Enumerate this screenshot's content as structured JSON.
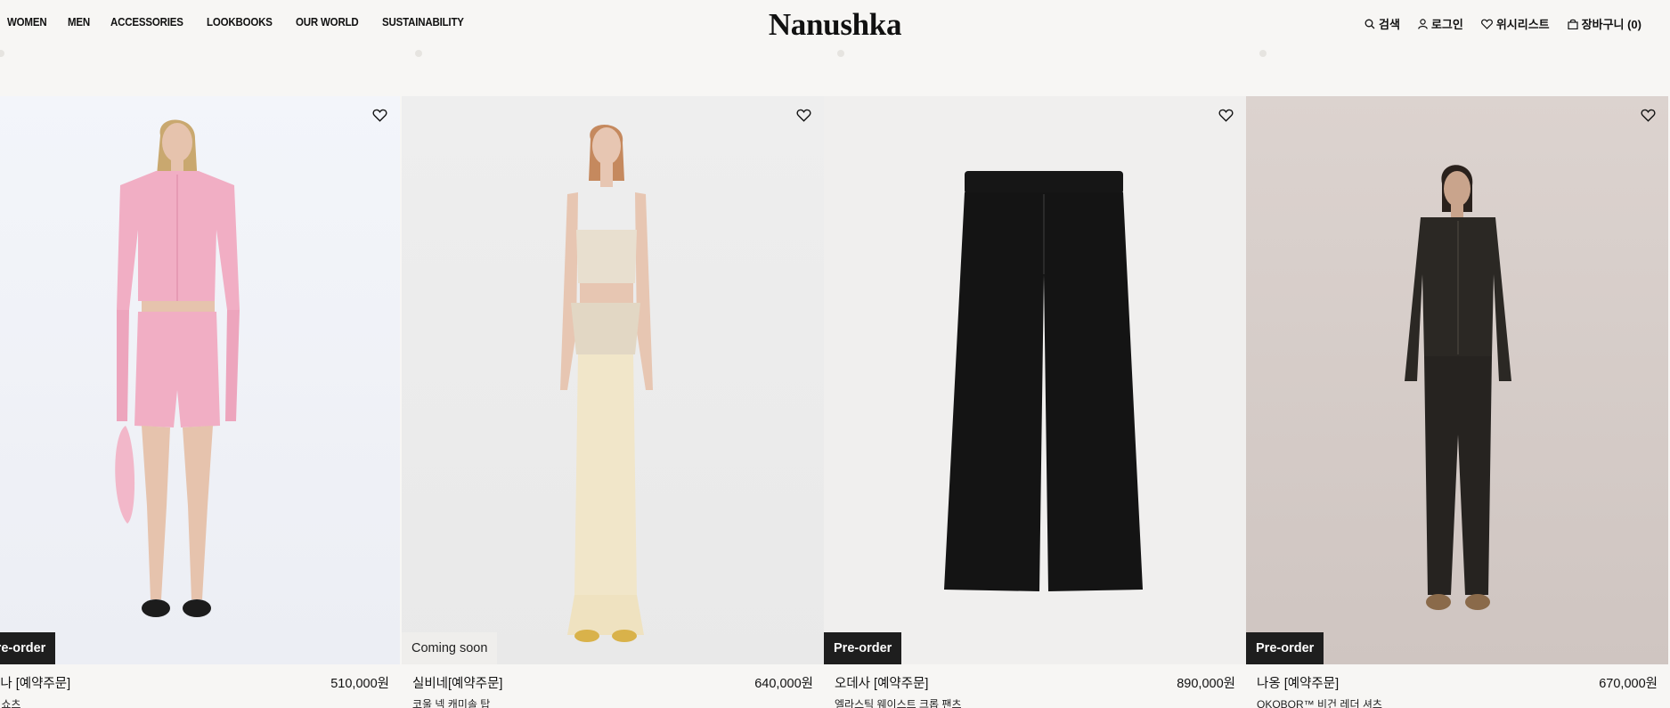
{
  "nav": [
    "WOMEN",
    "MEN",
    "ACCESSORIES",
    "LOOKBOOKS",
    "OUR WORLD",
    "SUSTAINABILITY"
  ],
  "brand": "Nanushka",
  "utilities": {
    "search": "검색",
    "login": "로그인",
    "wishlist": "위시리스트",
    "cart": "장바구니 (0)"
  },
  "products": [
    {
      "badge": "Pre-order",
      "badge_style": "dark",
      "name": "렌나 [예약주문]",
      "price": "510,000원",
      "subtitle": "서 쇼츠",
      "image": "model-pink-leather-set"
    },
    {
      "badge": "Coming soon",
      "badge_style": "light",
      "name": "실비네[예약주문]",
      "price": "640,000원",
      "subtitle": "코울 넥 캐미솔 탑",
      "image": "model-satin-cowl-camisole"
    },
    {
      "badge": "Pre-order",
      "badge_style": "dark",
      "name": "오데사 [예약주문]",
      "price": "890,000원",
      "subtitle": "엘라스틱 웨이스트 크롭 팬츠",
      "image": "black-wide-leg-trousers"
    },
    {
      "badge": "Pre-order",
      "badge_style": "dark",
      "name": "나옹 [예약주문]",
      "price": "670,000원",
      "subtitle": "OKOBOR™ 비건 레더 셔츠",
      "image": "model-black-leather-outfit"
    }
  ],
  "colors": {
    "background": "#f7f6f4",
    "badge_dark": "#1e1e1e",
    "text": "#111111"
  }
}
